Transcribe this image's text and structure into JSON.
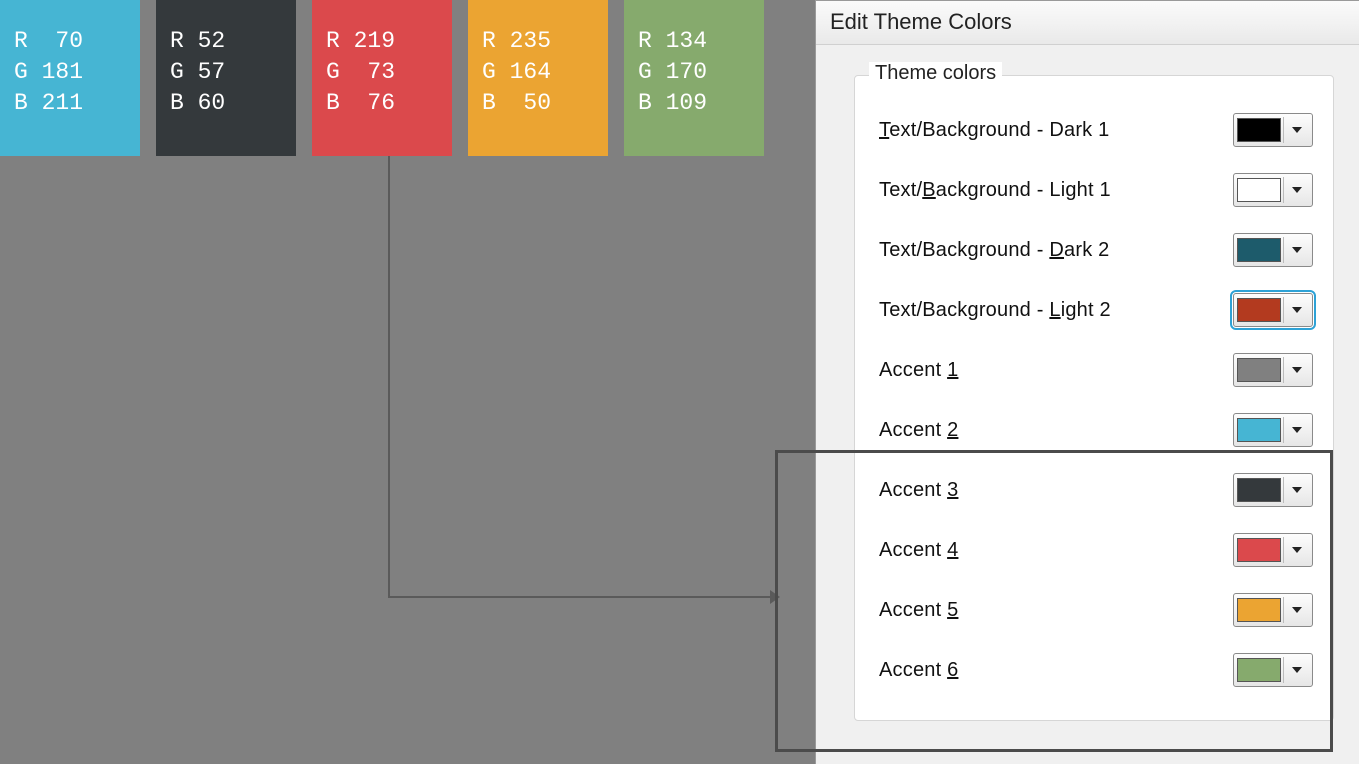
{
  "swatches": [
    {
      "bg": "#46b5d3",
      "text": "R  70\nG 181\nB 211"
    },
    {
      "bg": "#34393c",
      "text": "R 52\nG 57\nB 60"
    },
    {
      "bg": "#db494c",
      "text": "R 219\nG  73\nB  76"
    },
    {
      "bg": "#eba432",
      "text": "R 235\nG 164\nB  50"
    },
    {
      "bg": "#86aa6d",
      "text": "R 134\nG 170\nB 109"
    }
  ],
  "dialog": {
    "title": "Edit Theme Colors",
    "legend": "Theme colors",
    "rows": [
      {
        "label_html": "<span class=\"ul\">T</span>ext/Background - Dark 1",
        "color": "#000000",
        "selected": false
      },
      {
        "label_html": "Text/<span class=\"ul\">B</span>ackground - Light 1",
        "color": "#ffffff",
        "selected": false
      },
      {
        "label_html": "Text/Background - <span class=\"ul\">D</span>ark 2",
        "color": "#1d5b6b",
        "selected": false
      },
      {
        "label_html": "Text/Background - <span class=\"ul\">L</span>ight 2",
        "color": "#b33a1f",
        "selected": true
      },
      {
        "label_html": "Accent <span class=\"ul\">1</span>",
        "color": "#808080",
        "selected": false
      },
      {
        "label_html": "Accent <span class=\"ul\">2</span>",
        "color": "#46b5d3",
        "selected": false
      },
      {
        "label_html": "Accent <span class=\"ul\">3</span>",
        "color": "#34393c",
        "selected": false
      },
      {
        "label_html": "Accent <span class=\"ul\">4</span>",
        "color": "#db494c",
        "selected": false
      },
      {
        "label_html": "Accent <span class=\"ul\">5</span>",
        "color": "#eba432",
        "selected": false
      },
      {
        "label_html": "Accent <span class=\"ul\">6</span>",
        "color": "#86aa6d",
        "selected": false
      }
    ]
  }
}
